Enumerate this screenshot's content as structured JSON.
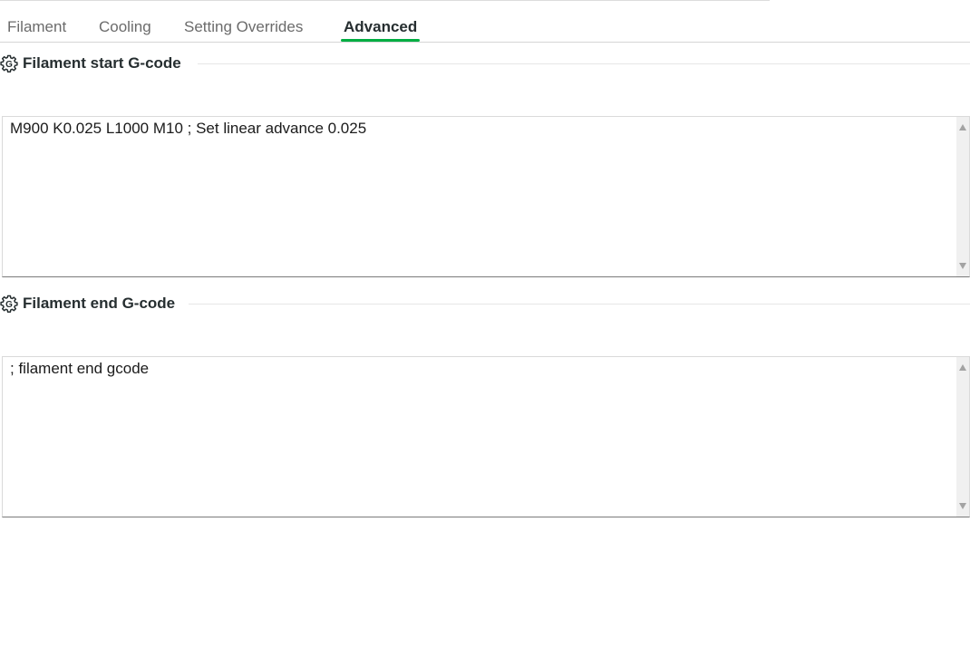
{
  "tabs": [
    {
      "label": "Filament",
      "active": false
    },
    {
      "label": "Cooling",
      "active": false
    },
    {
      "label": "Setting Overrides",
      "active": false
    },
    {
      "label": "Advanced",
      "active": true
    }
  ],
  "accent_color": "#00ae42",
  "sections": [
    {
      "icon": "gear-gcode-icon",
      "title": "Filament start G-code",
      "code": "M900 K0.025 L1000 M10 ; Set linear advance 0.025"
    },
    {
      "icon": "gear-gcode-icon",
      "title": "Filament end G-code",
      "code": "; filament end gcode"
    }
  ]
}
